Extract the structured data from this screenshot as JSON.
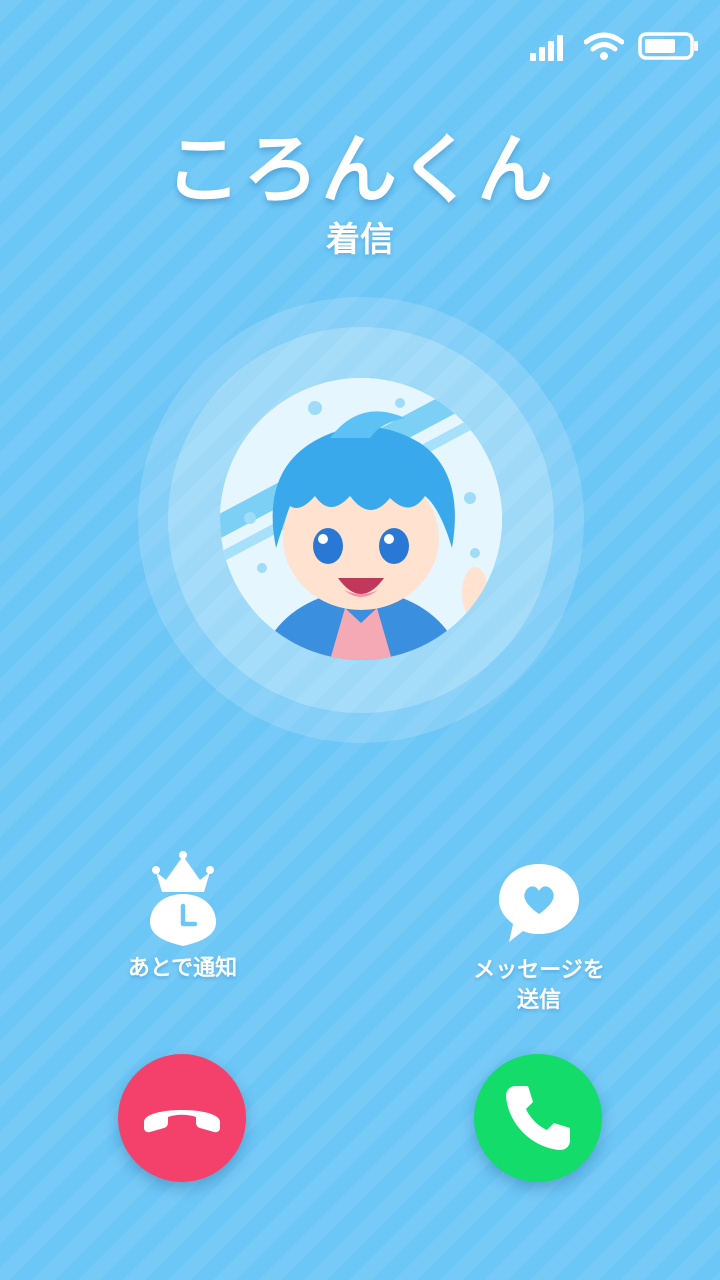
{
  "status_bar": {
    "icons": [
      "signal-icon",
      "wifi-icon",
      "battery-icon"
    ]
  },
  "caller": {
    "name": "ころんくん",
    "status": "着信"
  },
  "actions": {
    "remind_label": "あとで通知",
    "message_label_line1": "メッセージを",
    "message_label_line2": "送信"
  },
  "buttons": {
    "decline_icon": "phone-hangup-icon",
    "accept_icon": "phone-icon",
    "decline_color": "#f4416c",
    "accept_color": "#13dc6a"
  },
  "theme": {
    "background": "#6cc6f6",
    "text": "#ffffff"
  }
}
